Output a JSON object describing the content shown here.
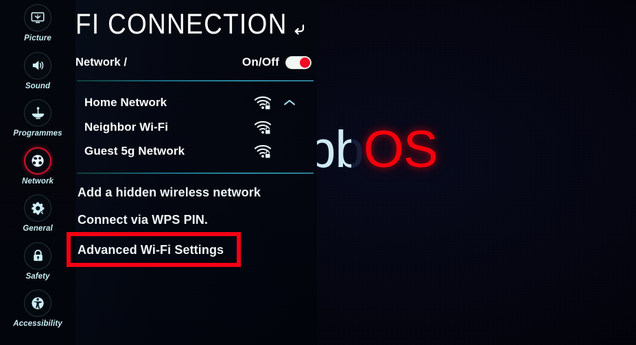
{
  "app": {
    "platform_logo_web": "web",
    "platform_logo_b": "b",
    "platform_logo_os": "OS"
  },
  "sidebar": {
    "items": [
      {
        "label": "Picture",
        "icon": "picture-icon",
        "selected": false
      },
      {
        "label": "Sound",
        "icon": "sound-icon",
        "selected": false
      },
      {
        "label": "Programmes",
        "icon": "programmes-icon",
        "selected": false
      },
      {
        "label": "Network",
        "icon": "network-globe-icon",
        "selected": true
      },
      {
        "label": "General",
        "icon": "general-gear-icon",
        "selected": false
      },
      {
        "label": "Safety",
        "icon": "safety-lock-icon",
        "selected": false
      },
      {
        "label": "Accessibility",
        "icon": "accessibility-icon",
        "selected": false
      }
    ],
    "selected_accent": "#d0142a"
  },
  "header": {
    "title": "FI CONNECTION",
    "breadcrumb": "Network /",
    "back_icon": "back-arrow-icon",
    "toggle_label": "On/Off",
    "toggle_state": "on",
    "toggle_knob_color": "#ef0a26"
  },
  "networks": {
    "items": [
      {
        "name": "Home Network",
        "signal_icon": "wifi-locked-icon",
        "secured": true,
        "expanded": true,
        "chevron": "chevron-up-icon"
      },
      {
        "name": "Neighbor Wi-Fi",
        "signal_icon": "wifi-locked-icon",
        "secured": true,
        "expanded": false,
        "chevron": ""
      },
      {
        "name": "Guest 5g Network",
        "signal_icon": "wifi-locked-icon",
        "secured": true,
        "expanded": false,
        "chevron": ""
      }
    ]
  },
  "actions": {
    "items": [
      {
        "label": "Add a hidden wireless network",
        "highlighted": false
      },
      {
        "label": "Connect via WPS PIN.",
        "highlighted": false
      },
      {
        "label": "Advanced Wi-Fi Settings",
        "highlighted": true
      }
    ]
  },
  "annotation": {
    "color": "#f60014",
    "target": "Advanced Wi-Fi Settings"
  }
}
